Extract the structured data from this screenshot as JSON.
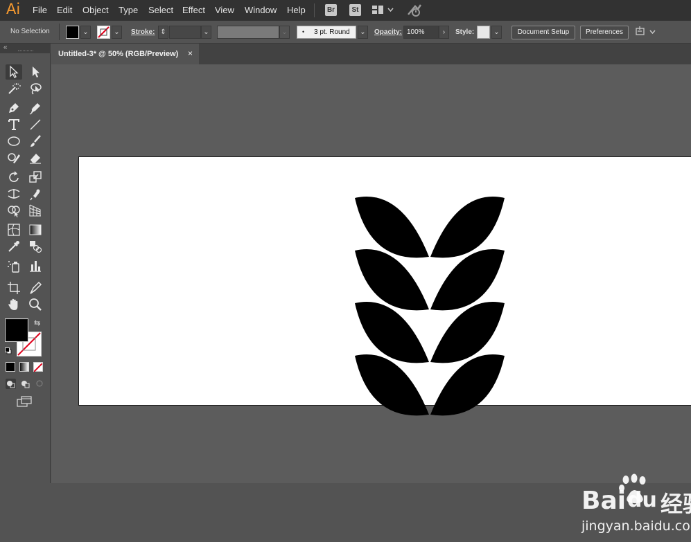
{
  "app": {
    "logo": "Ai",
    "brand_color": "#f79a2f"
  },
  "menu": [
    "File",
    "Edit",
    "Object",
    "Type",
    "Select",
    "Effect",
    "View",
    "Window",
    "Help"
  ],
  "app_buttons": {
    "bridge": "Br",
    "stock": "St"
  },
  "control_bar": {
    "selection_status": "No Selection",
    "stroke_label": "Stroke:",
    "brush_value": "3 pt. Round",
    "opacity_label": "Opacity:",
    "opacity_value": "100%",
    "style_label": "Style:",
    "document_setup_label": "Document Setup",
    "preferences_label": "Preferences"
  },
  "document": {
    "tab_title": "Untitled-3* @ 50% (RGB/Preview)",
    "close_glyph": "×"
  },
  "toolbar": {
    "fill_color": "#000000",
    "stroke": "none",
    "icons": [
      "selection-tool-icon",
      "direct-selection-tool-icon",
      "magic-wand-tool-icon",
      "lasso-tool-icon",
      "pen-tool-icon",
      "curvature-tool-icon",
      "type-tool-icon",
      "line-segment-tool-icon",
      "ellipse-tool-icon",
      "paintbrush-tool-icon",
      "shaper-tool-icon",
      "eraser-tool-icon",
      "rotate-tool-icon",
      "scale-tool-icon",
      "width-tool-icon",
      "puppet-warp-tool-icon",
      "shape-builder-tool-icon",
      "perspective-grid-tool-icon",
      "mesh-tool-icon",
      "gradient-tool-icon",
      "eyedropper-tool-icon",
      "blend-tool-icon",
      "symbol-sprayer-tool-icon",
      "column-graph-tool-icon",
      "artboard-tool-icon",
      "slice-tool-icon",
      "hand-tool-icon",
      "zoom-tool-icon"
    ]
  },
  "artwork": {
    "shape": "wheat-leaf-pattern",
    "fill_color": "#000000",
    "rows": 4
  },
  "watermark": {
    "brand": "Bai",
    "brand_suffix": "du",
    "product": "经验",
    "url": "jingyan.baidu.com"
  }
}
